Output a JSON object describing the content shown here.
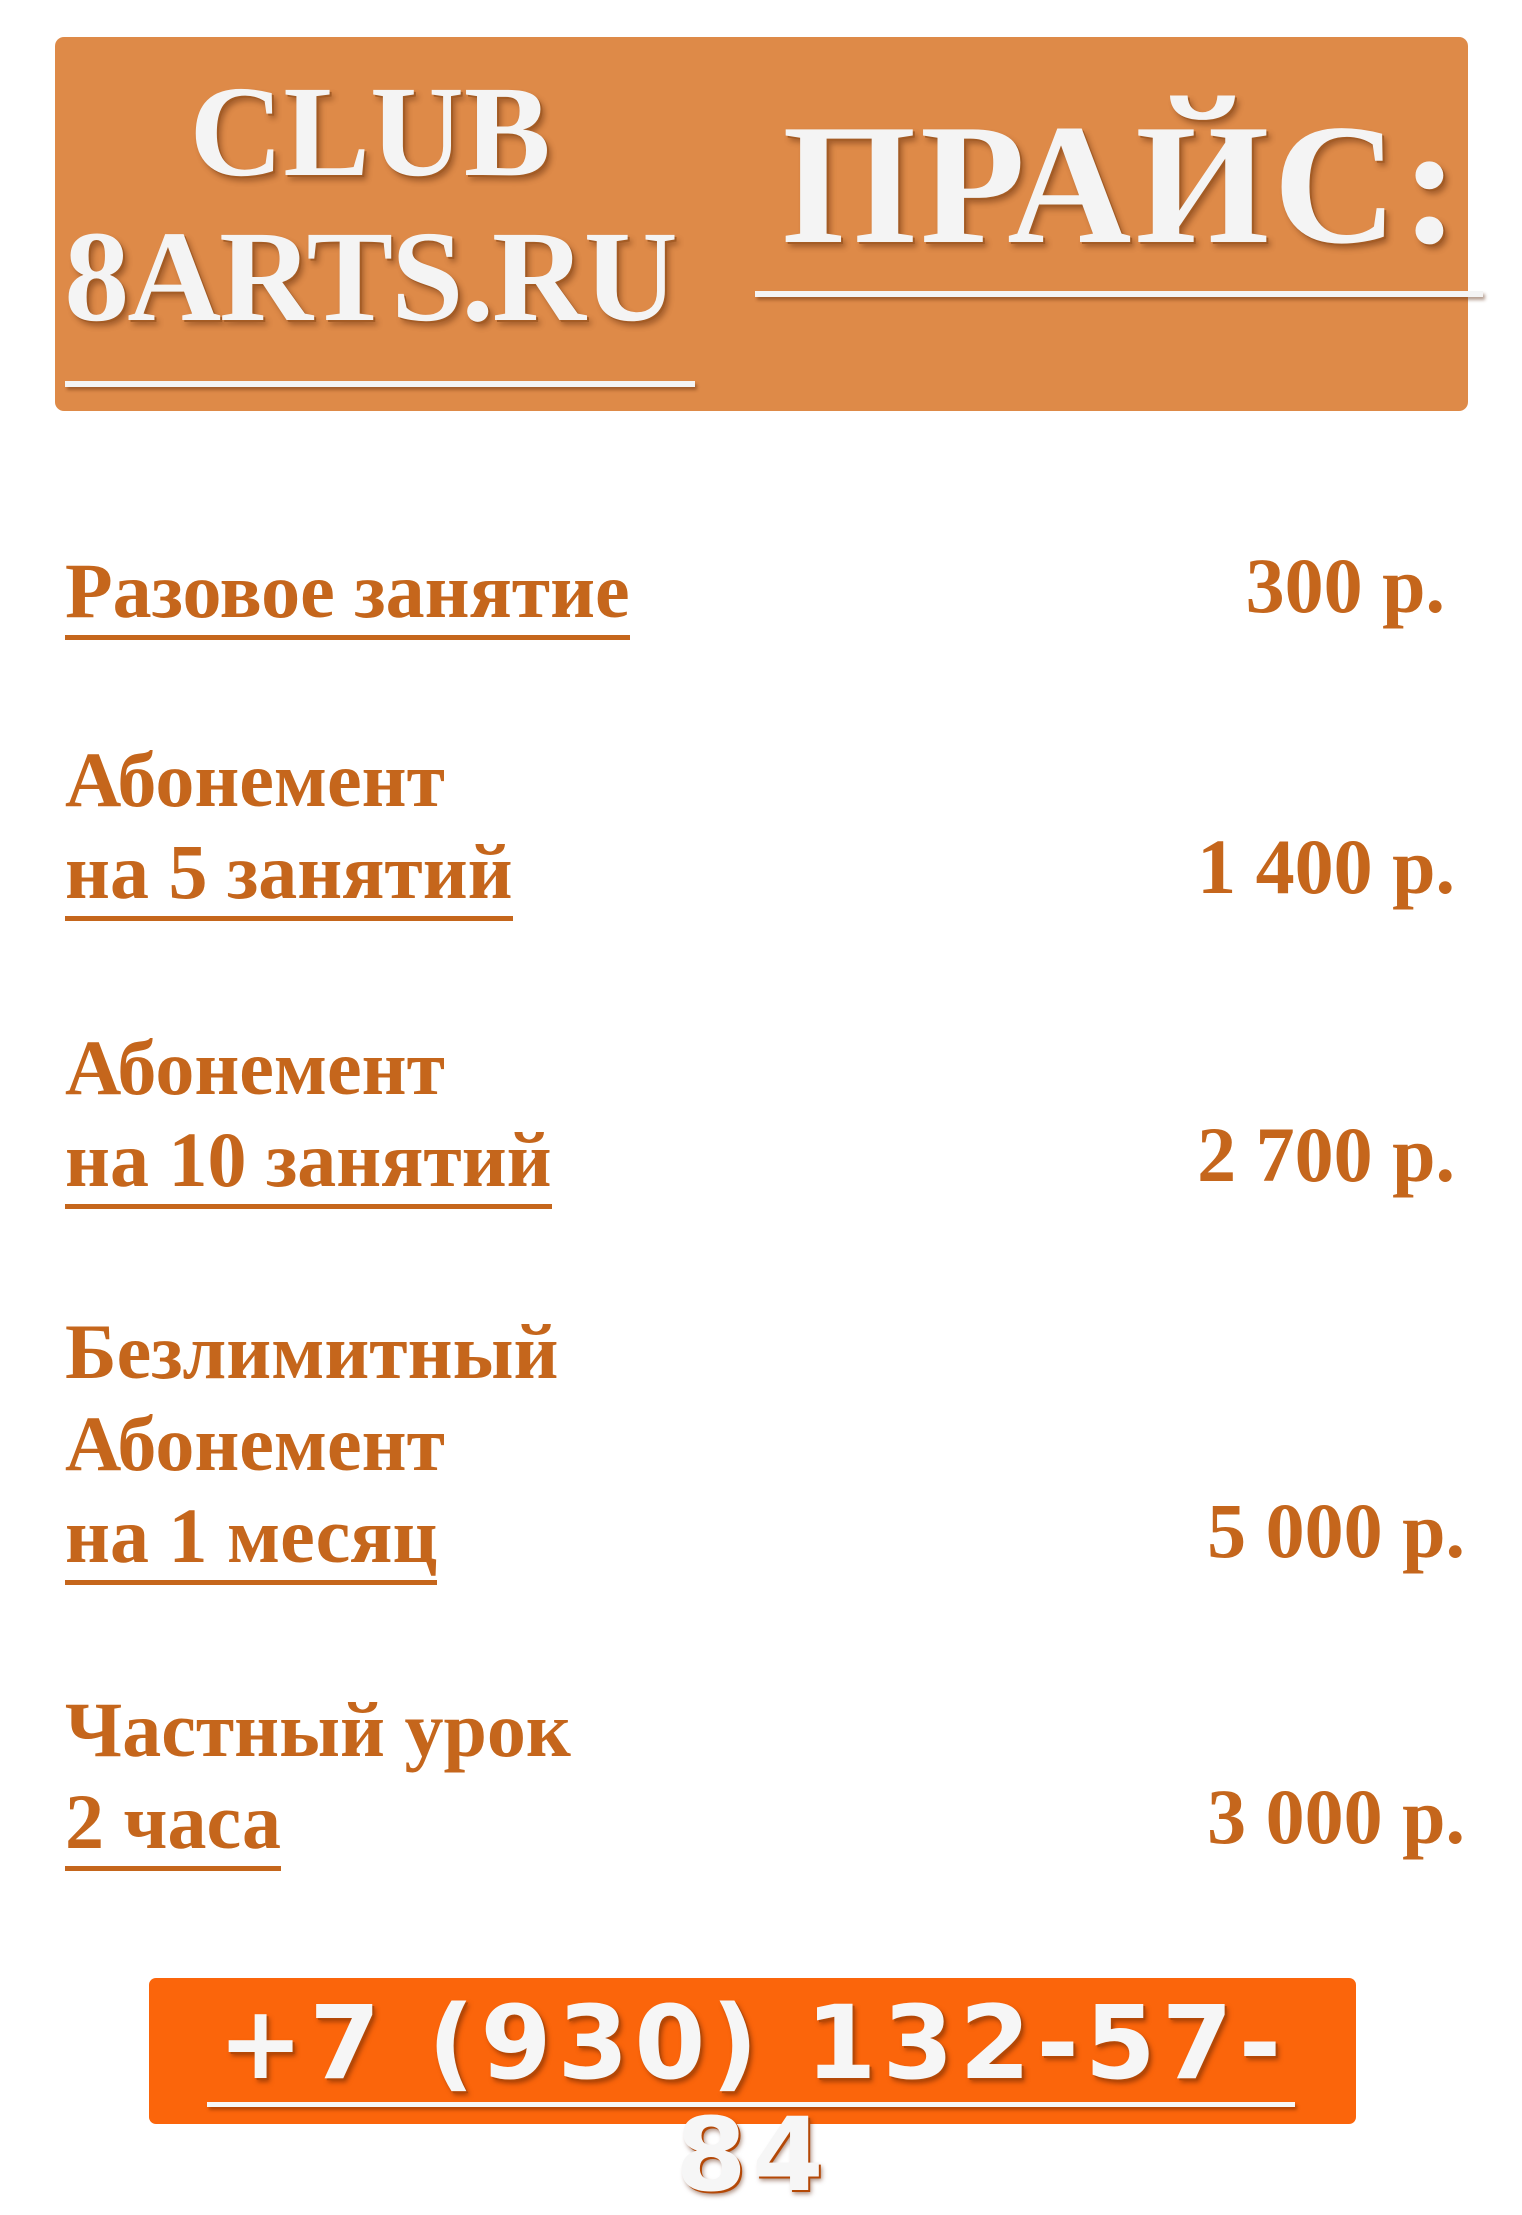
{
  "header": {
    "club_line1": "CLUB",
    "club_line2": "8ARTS.RU",
    "title": "ПРАЙС:"
  },
  "prices": [
    {
      "name_lines": [
        "Разовое занятие"
      ],
      "price": "300 р."
    },
    {
      "name_lines": [
        "Абонемент",
        "на 5 занятий"
      ],
      "price": "1 400 р."
    },
    {
      "name_lines": [
        "Абонемент",
        "на 10 занятий"
      ],
      "price": "2 700 р."
    },
    {
      "name_lines": [
        "Безлимитный",
        "Абонемент",
        "на 1 месяц"
      ],
      "price": "5 000 р."
    },
    {
      "name_lines": [
        "Частный урок",
        "2 часа"
      ],
      "price": "3 000 р."
    }
  ],
  "contact": {
    "phone": "+7 (930) 132-57-84"
  },
  "colors": {
    "header_bg": "#de8a48",
    "text_accent": "#c5661c",
    "phone_bg": "#fb650b",
    "embossed_text": "#f4f4f4"
  }
}
